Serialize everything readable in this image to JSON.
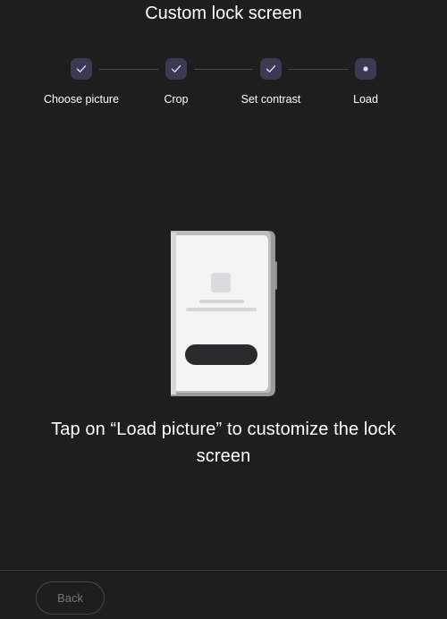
{
  "page": {
    "title": "Custom lock screen",
    "message": "Tap on “Load picture” to customize the lock screen"
  },
  "stepper": {
    "steps": [
      {
        "label": "Choose picture",
        "state": "done",
        "icon": "check-icon"
      },
      {
        "label": "Crop",
        "state": "done",
        "icon": "check-icon"
      },
      {
        "label": "Set contrast",
        "state": "done",
        "icon": "check-icon"
      },
      {
        "label": "Load",
        "state": "current",
        "icon": "dot-icon"
      }
    ]
  },
  "illustration": {
    "icon": "phone-illustration"
  },
  "footer": {
    "back_label": "Back"
  },
  "colors": {
    "background": "#1e1e1f",
    "step_badge": "#3b3a52",
    "step_icon": "#e0dcff",
    "divider": "#3a3a3c",
    "button_text_disabled": "#77777a"
  }
}
